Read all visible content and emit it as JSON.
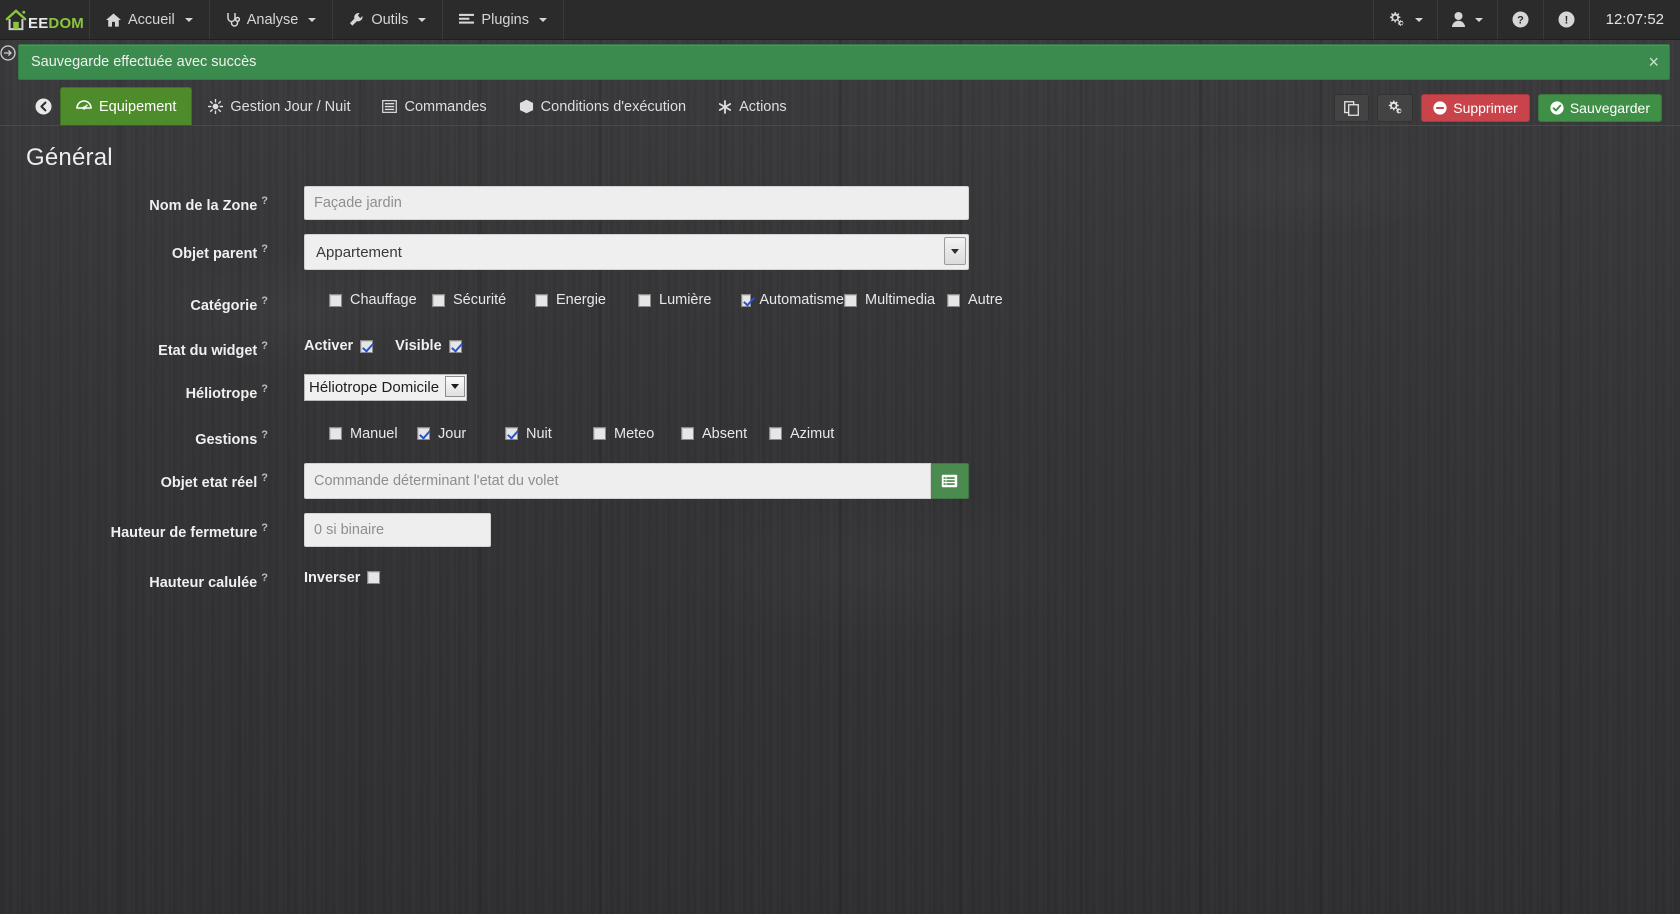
{
  "navbar": {
    "brand": {
      "white": "EE",
      "green": "DOM",
      "icon": "house-logo-icon"
    },
    "items": [
      {
        "label": "Accueil",
        "icon": "home-icon",
        "caret": true
      },
      {
        "label": "Analyse",
        "icon": "stethoscope-icon",
        "caret": true
      },
      {
        "label": "Outils",
        "icon": "wrench-icon",
        "caret": true
      },
      {
        "label": "Plugins",
        "icon": "list-icon",
        "caret": true
      }
    ],
    "right": [
      {
        "name": "gears-icon",
        "caret": true
      },
      {
        "name": "user-icon",
        "caret": true
      },
      {
        "name": "help-icon",
        "caret": false
      },
      {
        "name": "info-icon",
        "caret": false
      }
    ],
    "clock": "12:07:52"
  },
  "alert": {
    "message": "Sauvegarde effectuée avec succès",
    "close": "×",
    "color": "#3c8b4e"
  },
  "tabs": [
    {
      "label": "Equipement",
      "icon": "dashboard-icon",
      "active": true
    },
    {
      "label": "Gestion Jour / Nuit",
      "icon": "sun-icon",
      "active": false
    },
    {
      "label": "Commandes",
      "icon": "list-alt-icon",
      "active": false
    },
    {
      "label": "Conditions d'exécution",
      "icon": "cube-icon",
      "active": false
    },
    {
      "label": "Actions",
      "icon": "asterisk-icon",
      "active": false
    }
  ],
  "toolbar": {
    "duplicate_label": "",
    "config_label": "",
    "delete_label": "Supprimer",
    "save_label": "Sauvegarder",
    "delete_color": "#c9444a",
    "save_color": "#3f8f46"
  },
  "page": {
    "title": "Général"
  },
  "form": {
    "nom_zone": {
      "label": "Nom de la Zone",
      "placeholder": "Façade jardin",
      "value": ""
    },
    "objet_parent": {
      "label": "Objet parent",
      "value": "Appartement",
      "options": [
        "Appartement"
      ]
    },
    "categorie": {
      "label": "Catégorie",
      "items": [
        {
          "label": "Chauffage",
          "checked": false
        },
        {
          "label": "Sécurité",
          "checked": false
        },
        {
          "label": "Energie",
          "checked": false
        },
        {
          "label": "Lumière",
          "checked": false
        },
        {
          "label": "Automatisme",
          "checked": true
        },
        {
          "label": "Multimedia",
          "checked": false
        },
        {
          "label": "Autre",
          "checked": false
        }
      ]
    },
    "etat_widget": {
      "label": "Etat du widget",
      "activer_label": "Activer",
      "activer_checked": true,
      "visible_label": "Visible",
      "visible_checked": true
    },
    "heliotrope": {
      "label": "Héliotrope",
      "value": "Héliotrope Domicile",
      "options": [
        "Héliotrope Domicile"
      ]
    },
    "gestions": {
      "label": "Gestions",
      "items": [
        {
          "label": "Manuel",
          "checked": false
        },
        {
          "label": "Jour",
          "checked": true
        },
        {
          "label": "Nuit",
          "checked": true
        },
        {
          "label": "Meteo",
          "checked": false
        },
        {
          "label": "Absent",
          "checked": false
        },
        {
          "label": "Azimut",
          "checked": false
        }
      ]
    },
    "objet_etat_reel": {
      "label": "Objet etat réel",
      "placeholder": "Commande déterminant l'etat du volet",
      "value": "",
      "button_icon": "list-select-icon"
    },
    "hauteur_fermeture": {
      "label": "Hauteur de fermeture",
      "placeholder": "0 si binaire",
      "value": ""
    },
    "hauteur_calculee": {
      "label": "Hauteur calulée",
      "inverser_label": "Inverser",
      "inverser_checked": false
    }
  }
}
